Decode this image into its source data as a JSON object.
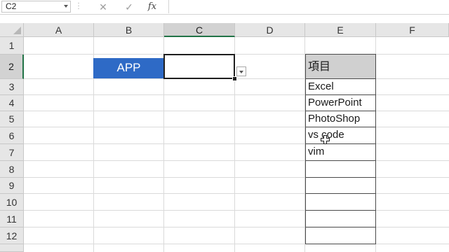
{
  "formula_bar": {
    "name_box": "C2",
    "cancel_icon": "close-icon",
    "enter_icon": "check-icon",
    "fx_label": "fx",
    "formula_value": ""
  },
  "sheet": {
    "columns": [
      "A",
      "B",
      "C",
      "D",
      "E",
      "F"
    ],
    "rows": [
      "1",
      "2",
      "3",
      "4",
      "5",
      "6",
      "7",
      "8",
      "9",
      "10",
      "11",
      "12"
    ],
    "active_cell": "C2",
    "cells": {
      "B2": "APP",
      "C2": "",
      "E2": "項目",
      "E3": "Excel",
      "E4": "PowerPoint",
      "E5": "PhotoShop",
      "E6": "vs code",
      "E7": "vim"
    },
    "colors": {
      "app_fill": "#2e6ac6",
      "header_fill": "#d0d0d0",
      "accent": "#217346"
    }
  }
}
